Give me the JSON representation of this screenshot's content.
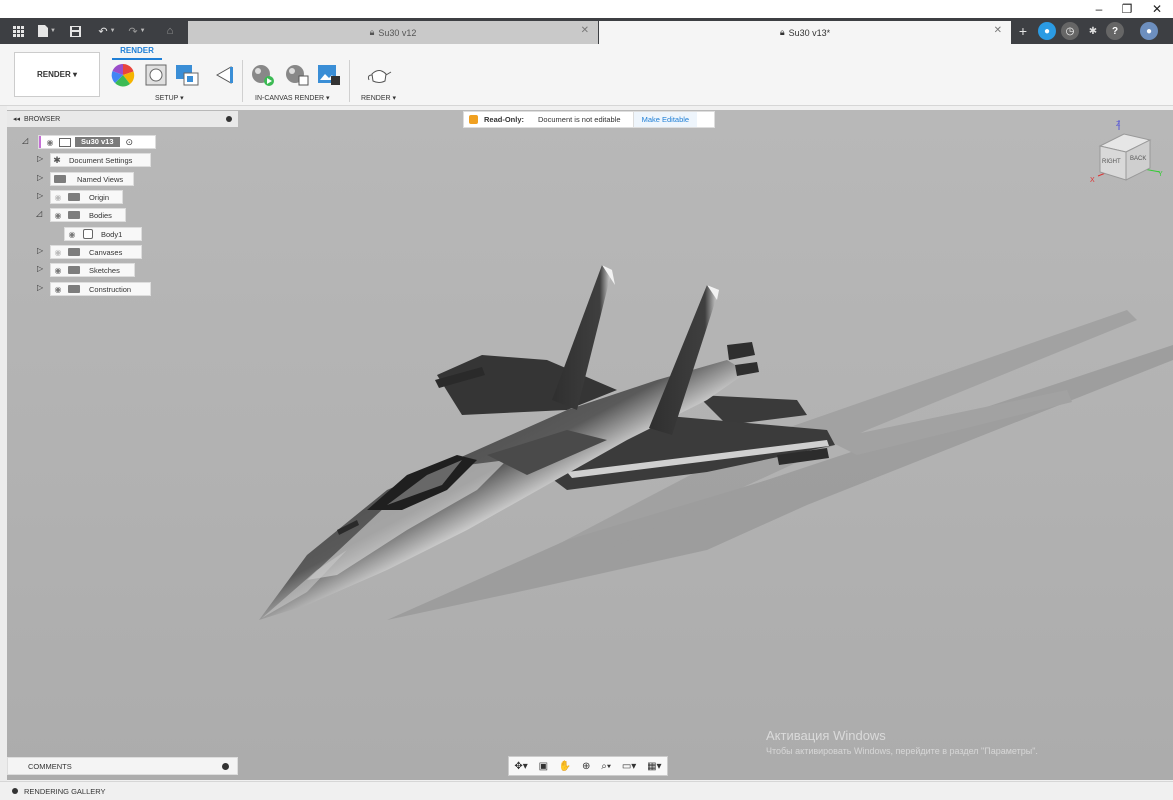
{
  "window": {
    "minimize": "–",
    "restore": "❐",
    "close": "✕"
  },
  "tabs": [
    {
      "label": "Su30 v12",
      "active": false
    },
    {
      "label": "Su30 v13*",
      "active": true
    }
  ],
  "toolbar": {
    "tab_label": "RENDER",
    "workspace_label": "RENDER ▾",
    "groups": {
      "setup": "SETUP ▾",
      "in_canvas": "IN-CANVAS RENDER ▾",
      "render": "RENDER ▾"
    }
  },
  "browser": {
    "header": "BROWSER",
    "root": "Su30 v13",
    "items": [
      {
        "label": "Document Settings"
      },
      {
        "label": "Named Views"
      },
      {
        "label": "Origin"
      },
      {
        "label": "Bodies"
      },
      {
        "label": "Body1"
      },
      {
        "label": "Canvases"
      },
      {
        "label": "Sketches"
      },
      {
        "label": "Construction"
      }
    ]
  },
  "banner": {
    "title": "Read-Only:",
    "message": "Document is not editable",
    "action": "Make Editable"
  },
  "viewcube": {
    "right": "RIGHT",
    "back": "BACK",
    "z": "Z",
    "x": "X",
    "y": "Y"
  },
  "bottom": {
    "comments": "COMMENTS",
    "gallery": "RENDERING GALLERY",
    "watermark_title": "Активация Windows",
    "watermark_text": "Чтобы активировать Windows, перейдите в раздел \"Параметры\"."
  },
  "colors": {
    "accent": "#1f7fd6",
    "canvas": "#b4b4b4",
    "tabbar": "#3d3f43",
    "aircraft": "#3a3a3a"
  }
}
